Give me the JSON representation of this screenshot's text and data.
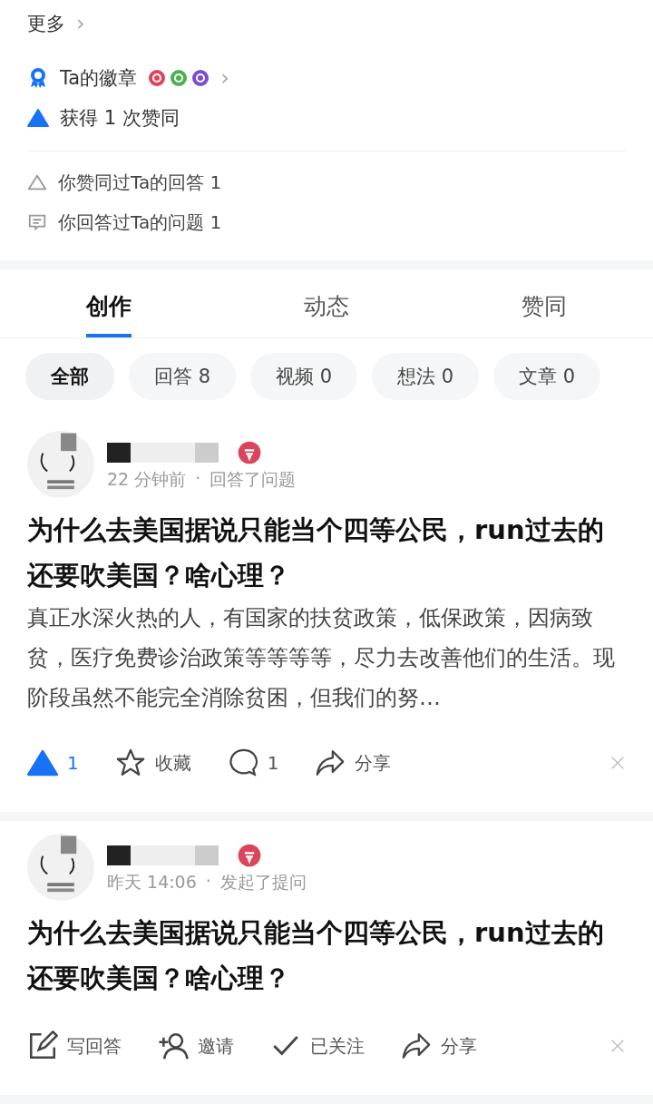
{
  "more": {
    "label": "更多",
    "chevron": "›"
  },
  "badges": {
    "label": "Ta的徽章",
    "chevron": "›",
    "items": [
      {
        "color": "#d9455a"
      },
      {
        "color": "#4caf50"
      },
      {
        "color": "#7b4bd1"
      }
    ]
  },
  "upvotes_received": "获得 1 次赞同",
  "relations": [
    {
      "kind": "upvote",
      "label": "你赞同过Ta的回答 1"
    },
    {
      "kind": "answer",
      "label": "你回答过Ta的问题 1"
    }
  ],
  "tabs": [
    {
      "label": "创作",
      "selected": true
    },
    {
      "label": "动态",
      "selected": false
    },
    {
      "label": "赞同",
      "selected": false
    }
  ],
  "filters": [
    {
      "label": "全部",
      "selected": true
    },
    {
      "label": "回答 8",
      "selected": false
    },
    {
      "label": "视频 0",
      "selected": false
    },
    {
      "label": "想法 0",
      "selected": false
    },
    {
      "label": "文章 0",
      "selected": false
    }
  ],
  "feed": [
    {
      "time": "22 分钟前",
      "separator": "·",
      "action": "回答了问题",
      "title": "为什么去美国据说只能当个四等公民，run过去的还要吹美国？啥心理？",
      "excerpt": "真正水深火热的人，有国家的扶贫政策，低保政策，因病致贫，医疗免费诊治政策等等等等，尽力去改善他们的生活。现阶段虽然不能完全消除贫困，但我们的努…",
      "actions": [
        {
          "kind": "upvote",
          "label": "1",
          "on": true
        },
        {
          "kind": "star",
          "label": "收藏"
        },
        {
          "kind": "comment",
          "label": "1"
        },
        {
          "kind": "share",
          "label": "分享"
        }
      ]
    },
    {
      "time": "昨天 14:06",
      "separator": "·",
      "action": "发起了提问",
      "title": "为什么去美国据说只能当个四等公民，run过去的还要吹美国？啥心理？",
      "actions": [
        {
          "kind": "write",
          "label": "写回答"
        },
        {
          "kind": "invite",
          "label": "邀请"
        },
        {
          "kind": "follow",
          "label": "已关注"
        },
        {
          "kind": "share",
          "label": "分享"
        }
      ]
    }
  ]
}
